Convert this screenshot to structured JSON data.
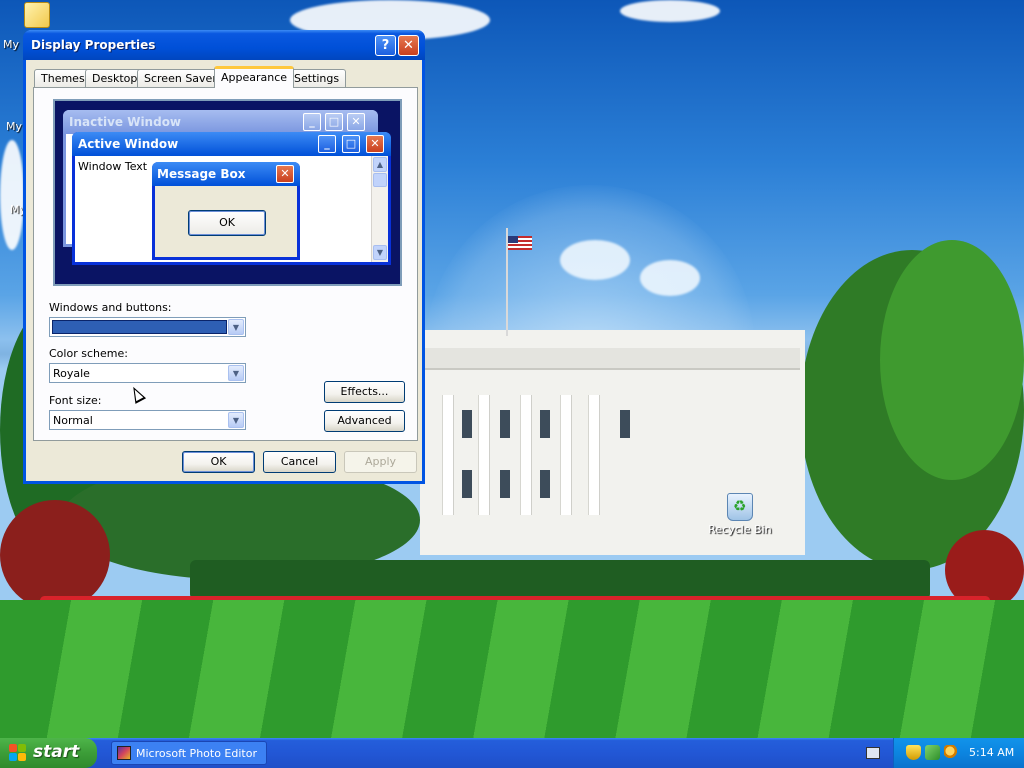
{
  "desktop": {
    "recycle_bin_label": "Recycle Bin",
    "my_icon_labels": [
      "My I",
      "My",
      "My"
    ]
  },
  "dialog": {
    "title": "Display Properties",
    "help_glyph": "?",
    "close_glyph": "✕",
    "tabs": [
      {
        "label": "Themes",
        "active": false
      },
      {
        "label": "Desktop",
        "active": false
      },
      {
        "label": "Screen Saver",
        "active": false
      },
      {
        "label": "Appearance",
        "active": true
      },
      {
        "label": "Settings",
        "active": false
      }
    ],
    "preview": {
      "inactive_title": "Inactive Window",
      "active_title": "Active Window",
      "window_text": "Window Text",
      "message_title": "Message Box",
      "message_ok": "OK"
    },
    "windows_and_buttons": {
      "label": "Windows and buttons:",
      "swatch_color": "#2e5fb4"
    },
    "color_scheme": {
      "label": "Color scheme:",
      "value": "Royale"
    },
    "font_size": {
      "label": "Font size:",
      "value": "Normal"
    },
    "effects_button": "Effects...",
    "advanced_button": "Advanced",
    "ok_button": "OK",
    "cancel_button": "Cancel",
    "apply_button": "Apply"
  },
  "taskbar": {
    "start_label": "start",
    "task_item_label": "Microsoft Photo Editor",
    "clock": "5:14 AM"
  },
  "colors": {
    "title_bar_blue": "#0050d8",
    "dialog_face": "#ece9d8",
    "taskbar_blue": "#245edb",
    "start_green": "#3c9d38"
  }
}
